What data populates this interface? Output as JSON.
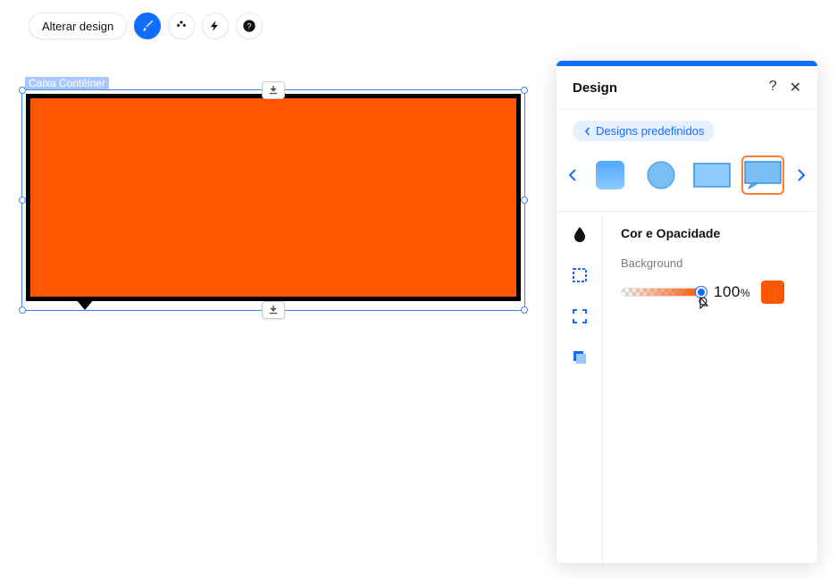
{
  "toolbar": {
    "change_design_label": "Alterar design"
  },
  "canvas": {
    "element_label": "Caixa Contêiner",
    "fill_color": "#ff5600",
    "border_color": "#000000"
  },
  "panel": {
    "title": "Design",
    "help_symbol": "?",
    "close_symbol": "✕",
    "breadcrumb_label": "Designs predefinidos",
    "section_title": "Cor e Opacidade",
    "background_label": "Background",
    "opacity_value": "100",
    "opacity_unit": "%",
    "swatch_color": "#ff5600",
    "shape_options": [
      "rounded-square",
      "circle",
      "rectangle",
      "callout"
    ],
    "selected_shape_index": 3
  }
}
